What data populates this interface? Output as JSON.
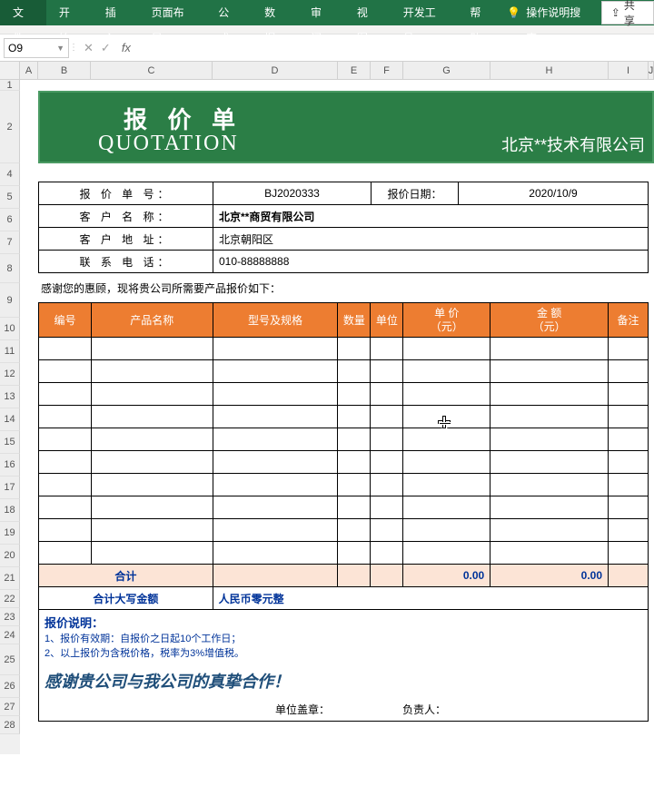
{
  "ribbon": {
    "tabs": [
      "文件",
      "开始",
      "插入",
      "页面布局",
      "公式",
      "数据",
      "审阅",
      "视图",
      "开发工具",
      "帮助"
    ],
    "tell_me": "操作说明搜索",
    "share": "共享"
  },
  "formula_bar": {
    "name_box": "O9",
    "fx_label": "fx",
    "cancel": "✕",
    "enter": "✓",
    "formula": ""
  },
  "columns": [
    "A",
    "B",
    "C",
    "D",
    "E",
    "F",
    "G",
    "H",
    "I",
    "J"
  ],
  "rows": [
    "1",
    "2",
    "4",
    "5",
    "6",
    "7",
    "8",
    "9",
    "10",
    "11",
    "12",
    "13",
    "14",
    "15",
    "16",
    "17",
    "18",
    "19",
    "20",
    "21",
    "22",
    "23",
    "24",
    "25",
    "26",
    "27",
    "28"
  ],
  "banner": {
    "title_cn": "报 价 单",
    "title_en": "QUOTATION",
    "company": "北京**技术有限公司"
  },
  "info": {
    "quote_no_label": "报 价 单 号：",
    "quote_no": "BJ2020333",
    "date_label": "报价日期：",
    "date": "2020/10/9",
    "client_name_label": "客 户 名 称：",
    "client_name": "北京**商贸有限公司",
    "client_addr_label": "客 户 地 址：",
    "client_addr": "北京朝阳区",
    "tel_label": "联 系 电 话：",
    "tel": "010-88888888"
  },
  "thanks_line": "感谢您的惠顾，现将贵公司所需要产品报价如下：",
  "items": {
    "headers": {
      "no": "编号",
      "name": "产品名称",
      "spec": "型号及规格",
      "qty": "数量",
      "unit": "单位",
      "price": "单 价\n（元）",
      "amount": "金 额\n（元）",
      "remark": "备注"
    },
    "rows": [
      {
        "no": "",
        "name": "",
        "spec": "",
        "qty": "",
        "unit": "",
        "price": "",
        "amount": "",
        "remark": ""
      },
      {
        "no": "",
        "name": "",
        "spec": "",
        "qty": "",
        "unit": "",
        "price": "",
        "amount": "",
        "remark": ""
      },
      {
        "no": "",
        "name": "",
        "spec": "",
        "qty": "",
        "unit": "",
        "price": "",
        "amount": "",
        "remark": ""
      },
      {
        "no": "",
        "name": "",
        "spec": "",
        "qty": "",
        "unit": "",
        "price": "",
        "amount": "",
        "remark": ""
      },
      {
        "no": "",
        "name": "",
        "spec": "",
        "qty": "",
        "unit": "",
        "price": "",
        "amount": "",
        "remark": ""
      },
      {
        "no": "",
        "name": "",
        "spec": "",
        "qty": "",
        "unit": "",
        "price": "",
        "amount": "",
        "remark": ""
      },
      {
        "no": "",
        "name": "",
        "spec": "",
        "qty": "",
        "unit": "",
        "price": "",
        "amount": "",
        "remark": ""
      },
      {
        "no": "",
        "name": "",
        "spec": "",
        "qty": "",
        "unit": "",
        "price": "",
        "amount": "",
        "remark": ""
      },
      {
        "no": "",
        "name": "",
        "spec": "",
        "qty": "",
        "unit": "",
        "price": "",
        "amount": "",
        "remark": ""
      },
      {
        "no": "",
        "name": "",
        "spec": "",
        "qty": "",
        "unit": "",
        "price": "",
        "amount": "",
        "remark": ""
      }
    ],
    "sum_label": "合计",
    "sum_price": "0.00",
    "sum_amount": "0.00",
    "caps_label": "合计大写金额",
    "caps_value": "人民币零元整"
  },
  "notes": {
    "head": "报价说明：",
    "line1": "1、报价有效期：自报价之日起10个工作日；",
    "line2": "2、以上报价为含税价格，税率为3%增值税。"
  },
  "thanks_big": "感谢贵公司与我公司的真挚合作！",
  "sign": {
    "seal": "单位盖章：",
    "resp": "负责人："
  }
}
